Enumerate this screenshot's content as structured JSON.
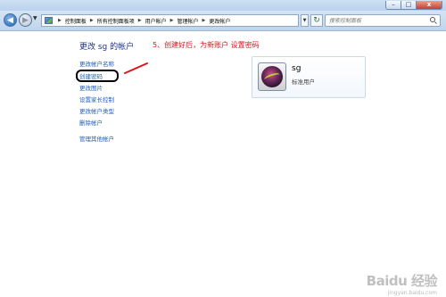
{
  "window": {
    "minimize_glyph": "–",
    "maximize_glyph": "□",
    "close_glyph": "x"
  },
  "navigation": {
    "breadcrumbs": [
      "控制面板",
      "所有控制面板项",
      "用户帐户",
      "管理帐户",
      "更改帐户"
    ],
    "search_placeholder": "搜索控制面板",
    "refresh_glyph": "↻"
  },
  "page": {
    "title": "更改 sg 的帐户",
    "annotation": "5、创建好后，为新账户   设置密码",
    "links": [
      "更改帐户名称",
      "创建密码",
      "更改图片",
      "设置家长控制",
      "更改帐户类型",
      "删除帐户",
      "管理其他帐户"
    ]
  },
  "account": {
    "name": "sg",
    "type": "标准用户"
  },
  "watermark": {
    "logo_text": "Baidu 经验",
    "url": "jingyan.baidu.com"
  },
  "colors": {
    "link": "#1e5ebf",
    "title": "#1e3287",
    "annotation": "#e0101a",
    "chrome": "#c9dcf0"
  }
}
